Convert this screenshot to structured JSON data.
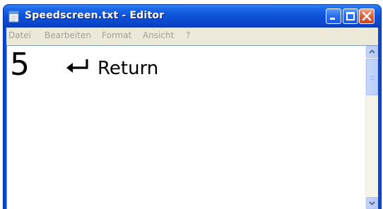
{
  "window": {
    "title": "Speedscreen.txt - Editor",
    "app_icon": "notepad-icon",
    "controls": [
      "minimize-icon",
      "maximize-icon",
      "close-icon"
    ]
  },
  "menu": {
    "items": [
      {
        "label": "Datei"
      },
      {
        "label": "Bearbeiten"
      },
      {
        "label": "Format"
      },
      {
        "label": "Ansicht"
      },
      {
        "label": "?"
      }
    ]
  },
  "editor": {
    "digit": "5",
    "return_icon": "return-arrow-icon",
    "return_label": "Return"
  },
  "colors": {
    "titlebar": "#0c4fd7",
    "close_button": "#e2693f",
    "menu_text": "#a19f97",
    "window_body": "#ece9d8"
  }
}
